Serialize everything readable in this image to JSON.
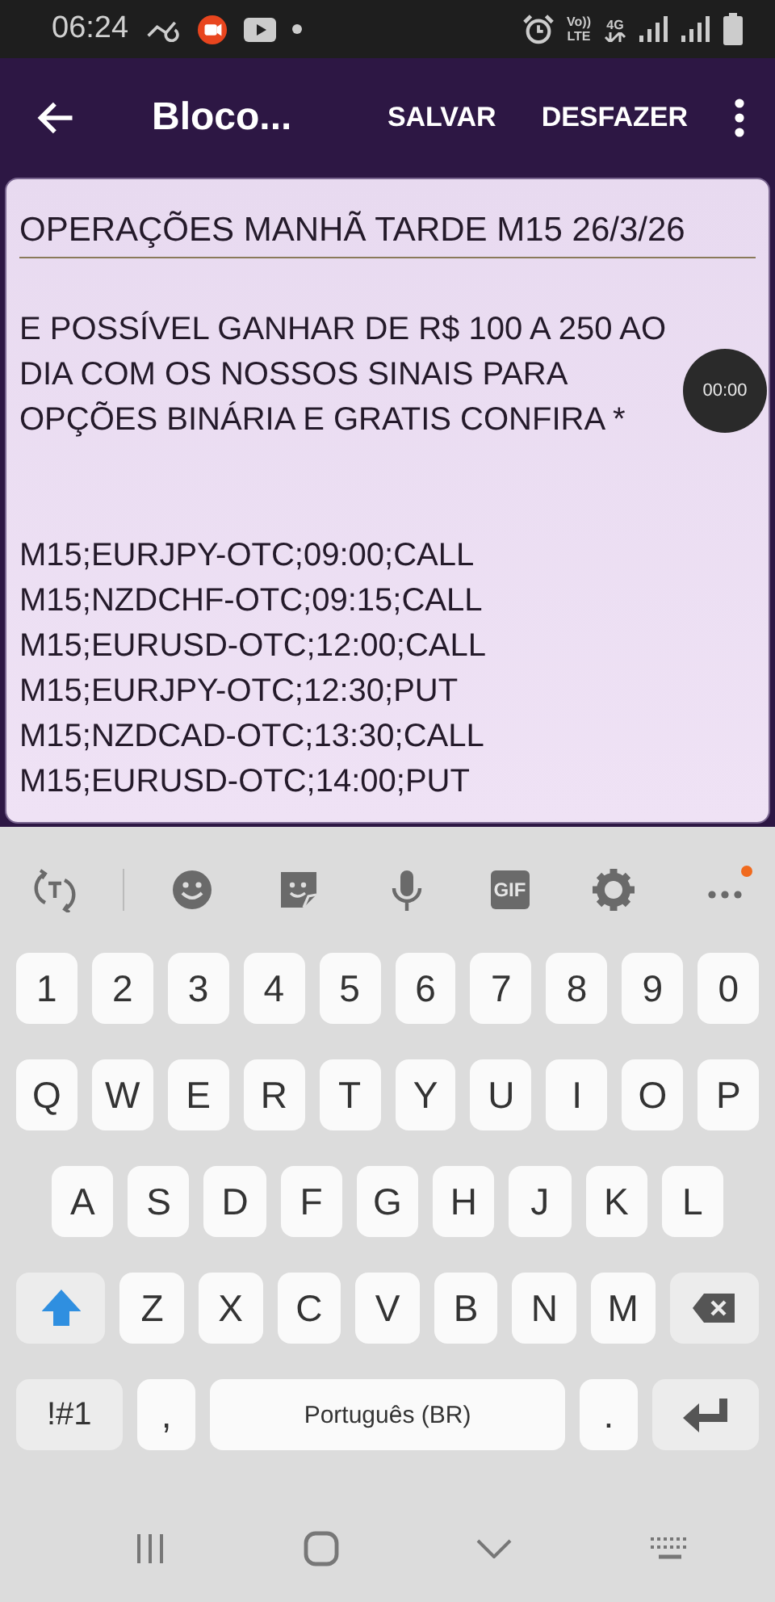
{
  "status_bar": {
    "time": "06:24",
    "volte_top": "Vo))",
    "volte_bottom": "LTE",
    "network": "4G"
  },
  "app_bar": {
    "title": "Bloco...",
    "actions": [
      "SALVAR",
      "DESFAZER"
    ]
  },
  "note": {
    "title": "OPERAÇÕES MANHÃ  TARDE M15 26/3/26",
    "intro": [
      "E POSSÍVEL GANHAR DE R$ 100 A 250 AO",
      "DIA COM OS NOSSOS SINAIS PARA",
      "OPÇÕES BINÁRIA E GRATIS CONFIRA *"
    ],
    "signals": [
      "M15;EURJPY-OTC;09:00;CALL",
      "M15;NZDCHF-OTC;09:15;CALL",
      "M15;EURUSD-OTC;12:00;CALL",
      "M15;EURJPY-OTC;12:30;PUT",
      "M15;NZDCAD-OTC;13:30;CALL",
      "M15;EURUSD-OTC;14:00;PUT"
    ]
  },
  "recorder": {
    "time": "00:00"
  },
  "keyboard": {
    "toolbar": [
      {
        "kind": "translate"
      },
      {
        "kind": "emoji"
      },
      {
        "kind": "sticker"
      },
      {
        "kind": "mic"
      },
      {
        "kind": "gif",
        "label": "GIF"
      },
      {
        "kind": "settings"
      },
      {
        "kind": "more",
        "badge": true
      }
    ],
    "rows": [
      [
        {
          "kind": "char",
          "label": "1"
        },
        {
          "kind": "char",
          "label": "2"
        },
        {
          "kind": "char",
          "label": "3"
        },
        {
          "kind": "char",
          "label": "4"
        },
        {
          "kind": "char",
          "label": "5"
        },
        {
          "kind": "char",
          "label": "6"
        },
        {
          "kind": "char",
          "label": "7"
        },
        {
          "kind": "char",
          "label": "8"
        },
        {
          "kind": "char",
          "label": "9"
        },
        {
          "kind": "char",
          "label": "0"
        }
      ],
      [
        {
          "kind": "char",
          "label": "Q"
        },
        {
          "kind": "char",
          "label": "W"
        },
        {
          "kind": "char",
          "label": "E"
        },
        {
          "kind": "char",
          "label": "R"
        },
        {
          "kind": "char",
          "label": "T"
        },
        {
          "kind": "char",
          "label": "Y"
        },
        {
          "kind": "char",
          "label": "U"
        },
        {
          "kind": "char",
          "label": "I"
        },
        {
          "kind": "char",
          "label": "O"
        },
        {
          "kind": "char",
          "label": "P"
        }
      ],
      [
        {
          "kind": "char",
          "label": "A"
        },
        {
          "kind": "char",
          "label": "S"
        },
        {
          "kind": "char",
          "label": "D"
        },
        {
          "kind": "char",
          "label": "F"
        },
        {
          "kind": "char",
          "label": "G"
        },
        {
          "kind": "char",
          "label": "H"
        },
        {
          "kind": "char",
          "label": "J"
        },
        {
          "kind": "char",
          "label": "K"
        },
        {
          "kind": "char",
          "label": "L"
        }
      ],
      [
        {
          "kind": "shift",
          "on": true
        },
        {
          "kind": "char",
          "label": "Z"
        },
        {
          "kind": "char",
          "label": "X"
        },
        {
          "kind": "char",
          "label": "C"
        },
        {
          "kind": "char",
          "label": "V"
        },
        {
          "kind": "char",
          "label": "B"
        },
        {
          "kind": "char",
          "label": "N"
        },
        {
          "kind": "char",
          "label": "M"
        },
        {
          "kind": "backspace"
        }
      ]
    ],
    "bottom_row": {
      "symbols": "!#1",
      "comma": ",",
      "space": "Português (BR)",
      "period": "."
    }
  }
}
